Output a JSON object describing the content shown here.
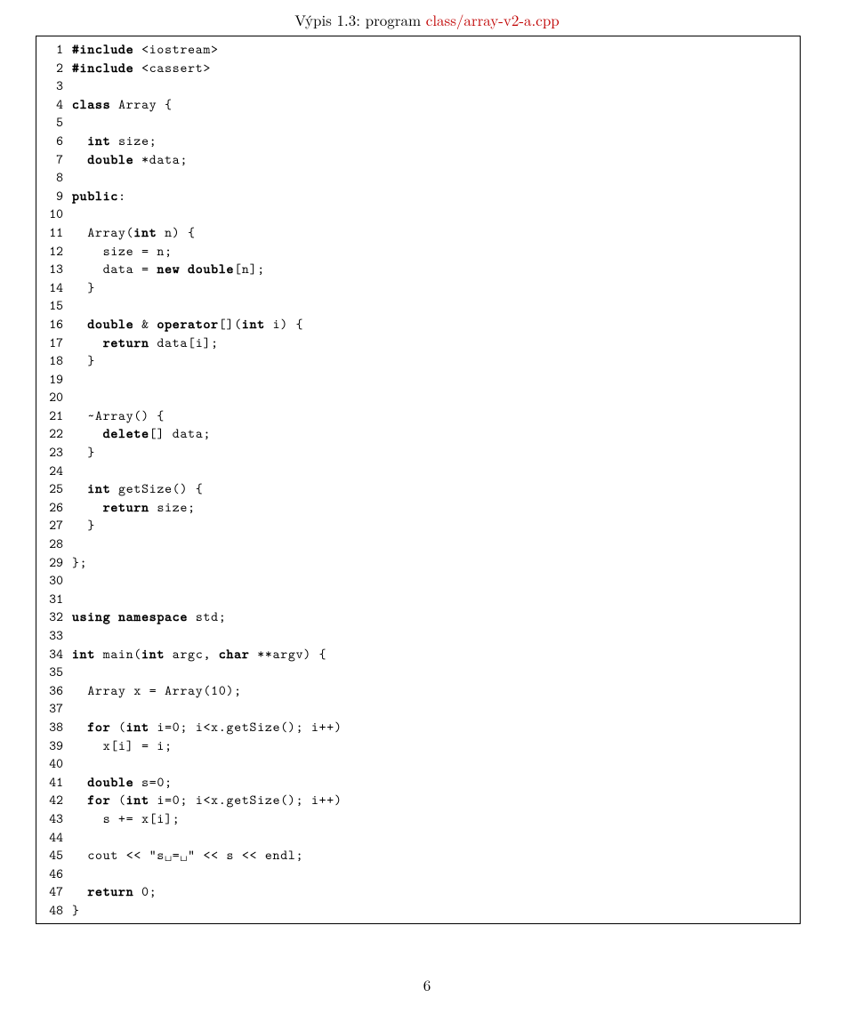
{
  "caption_prefix": "Výpis 1.3: program ",
  "caption_link": "class/array-v2-a.cpp",
  "page_number": "6",
  "lines": [
    {
      "n": "1",
      "tokens": [
        {
          "t": "#include",
          "c": "pp"
        },
        {
          "t": " <iostream>"
        }
      ]
    },
    {
      "n": "2",
      "tokens": [
        {
          "t": "#include",
          "c": "pp"
        },
        {
          "t": " <cassert>"
        }
      ]
    },
    {
      "n": "3",
      "tokens": []
    },
    {
      "n": "4",
      "tokens": [
        {
          "t": "class",
          "c": "kw"
        },
        {
          "t": " Array {"
        }
      ]
    },
    {
      "n": "5",
      "tokens": []
    },
    {
      "n": "6",
      "tokens": [
        {
          "t": "  "
        },
        {
          "t": "int",
          "c": "kw"
        },
        {
          "t": " size;"
        }
      ]
    },
    {
      "n": "7",
      "tokens": [
        {
          "t": "  "
        },
        {
          "t": "double",
          "c": "kw"
        },
        {
          "t": " *data;"
        }
      ]
    },
    {
      "n": "8",
      "tokens": []
    },
    {
      "n": "9",
      "tokens": [
        {
          "t": "public",
          "c": "kw"
        },
        {
          "t": ":"
        }
      ]
    },
    {
      "n": "10",
      "tokens": []
    },
    {
      "n": "11",
      "tokens": [
        {
          "t": "  Array("
        },
        {
          "t": "int",
          "c": "kw"
        },
        {
          "t": " n) {"
        }
      ]
    },
    {
      "n": "12",
      "tokens": [
        {
          "t": "    size = n;"
        }
      ]
    },
    {
      "n": "13",
      "tokens": [
        {
          "t": "    data = "
        },
        {
          "t": "new",
          "c": "kw"
        },
        {
          "t": " "
        },
        {
          "t": "double",
          "c": "kw"
        },
        {
          "t": "[n];"
        }
      ]
    },
    {
      "n": "14",
      "tokens": [
        {
          "t": "  }"
        }
      ]
    },
    {
      "n": "15",
      "tokens": []
    },
    {
      "n": "16",
      "tokens": [
        {
          "t": "  "
        },
        {
          "t": "double",
          "c": "kw"
        },
        {
          "t": " & "
        },
        {
          "t": "operator",
          "c": "kw"
        },
        {
          "t": "[]("
        },
        {
          "t": "int",
          "c": "kw"
        },
        {
          "t": " i) {"
        }
      ]
    },
    {
      "n": "17",
      "tokens": [
        {
          "t": "    "
        },
        {
          "t": "return",
          "c": "kw"
        },
        {
          "t": " data[i];"
        }
      ]
    },
    {
      "n": "18",
      "tokens": [
        {
          "t": "  }"
        }
      ]
    },
    {
      "n": "19",
      "tokens": []
    },
    {
      "n": "20",
      "tokens": []
    },
    {
      "n": "21",
      "tokens": [
        {
          "t": "  ~Array() {"
        }
      ]
    },
    {
      "n": "22",
      "tokens": [
        {
          "t": "    "
        },
        {
          "t": "delete",
          "c": "kw"
        },
        {
          "t": "[] data;"
        }
      ]
    },
    {
      "n": "23",
      "tokens": [
        {
          "t": "  }"
        }
      ]
    },
    {
      "n": "24",
      "tokens": []
    },
    {
      "n": "25",
      "tokens": [
        {
          "t": "  "
        },
        {
          "t": "int",
          "c": "kw"
        },
        {
          "t": " getSize() {"
        }
      ]
    },
    {
      "n": "26",
      "tokens": [
        {
          "t": "    "
        },
        {
          "t": "return",
          "c": "kw"
        },
        {
          "t": " size;"
        }
      ]
    },
    {
      "n": "27",
      "tokens": [
        {
          "t": "  }"
        }
      ]
    },
    {
      "n": "28",
      "tokens": []
    },
    {
      "n": "29",
      "tokens": [
        {
          "t": "};"
        }
      ]
    },
    {
      "n": "30",
      "tokens": []
    },
    {
      "n": "31",
      "tokens": []
    },
    {
      "n": "32",
      "tokens": [
        {
          "t": "using",
          "c": "kw"
        },
        {
          "t": " "
        },
        {
          "t": "namespace",
          "c": "kw"
        },
        {
          "t": " std;"
        }
      ]
    },
    {
      "n": "33",
      "tokens": []
    },
    {
      "n": "34",
      "tokens": [
        {
          "t": "int",
          "c": "kw"
        },
        {
          "t": " main("
        },
        {
          "t": "int",
          "c": "kw"
        },
        {
          "t": " argc, "
        },
        {
          "t": "char",
          "c": "kw"
        },
        {
          "t": " **argv) {"
        }
      ]
    },
    {
      "n": "35",
      "tokens": []
    },
    {
      "n": "36",
      "tokens": [
        {
          "t": "  Array x = Array(10);"
        }
      ]
    },
    {
      "n": "37",
      "tokens": []
    },
    {
      "n": "38",
      "tokens": [
        {
          "t": "  "
        },
        {
          "t": "for",
          "c": "kw"
        },
        {
          "t": " ("
        },
        {
          "t": "int",
          "c": "kw"
        },
        {
          "t": " i=0; i<x.getSize(); i++)"
        }
      ]
    },
    {
      "n": "39",
      "tokens": [
        {
          "t": "    x[i] = i;"
        }
      ]
    },
    {
      "n": "40",
      "tokens": []
    },
    {
      "n": "41",
      "tokens": [
        {
          "t": "  "
        },
        {
          "t": "double",
          "c": "kw"
        },
        {
          "t": " s=0;"
        }
      ]
    },
    {
      "n": "42",
      "tokens": [
        {
          "t": "  "
        },
        {
          "t": "for",
          "c": "kw"
        },
        {
          "t": " ("
        },
        {
          "t": "int",
          "c": "kw"
        },
        {
          "t": " i=0; i<x.getSize(); i++)"
        }
      ]
    },
    {
      "n": "43",
      "tokens": [
        {
          "t": "    s += x[i];"
        }
      ]
    },
    {
      "n": "44",
      "tokens": []
    },
    {
      "n": "45",
      "tokens": [
        {
          "t": "  cout << \"s␣=␣\" << s << endl;"
        }
      ]
    },
    {
      "n": "46",
      "tokens": []
    },
    {
      "n": "47",
      "tokens": [
        {
          "t": "  "
        },
        {
          "t": "return",
          "c": "kw"
        },
        {
          "t": " 0;"
        }
      ]
    },
    {
      "n": "48",
      "tokens": [
        {
          "t": "}"
        }
      ]
    }
  ]
}
